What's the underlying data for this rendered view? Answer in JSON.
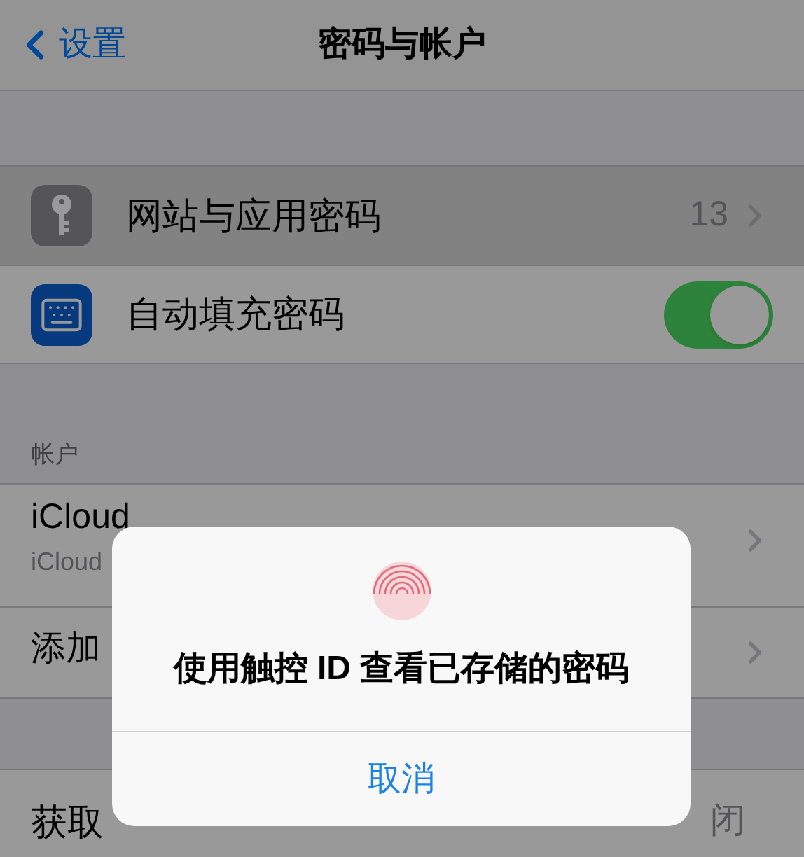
{
  "nav": {
    "back": "设置",
    "title": "密码与帐户"
  },
  "settings": [
    {
      "kind": "link",
      "label": "网站与应用密码",
      "value": "13",
      "selected": true
    },
    {
      "kind": "toggle",
      "label": "自动填充密码",
      "on": true,
      "selected": false
    }
  ],
  "accounts_section": {
    "header": "帐户",
    "rows": [
      {
        "title": "iCloud",
        "subtitle": "iCloud"
      },
      {
        "title": "添加"
      }
    ]
  },
  "fetch_row": {
    "label": "获取",
    "value": "闭"
  },
  "alert": {
    "message": "使用触控 ID 查看已存储的密码",
    "button": "取消"
  }
}
